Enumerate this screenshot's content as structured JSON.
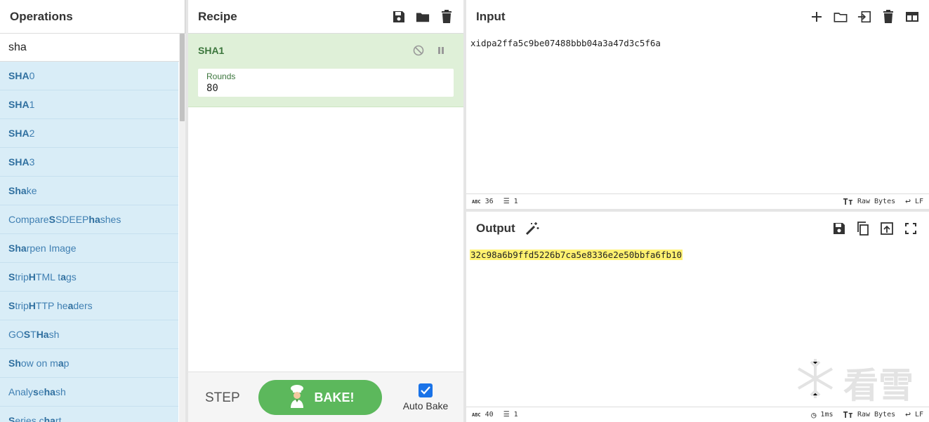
{
  "operations": {
    "title": "Operations",
    "search_value": "sha",
    "items": [
      {
        "pre": "",
        "bold": "SHA",
        "post": "0"
      },
      {
        "pre": "",
        "bold": "SHA",
        "post": "1"
      },
      {
        "pre": "",
        "bold": "SHA",
        "post": "2"
      },
      {
        "pre": "",
        "bold": "SHA",
        "post": "3"
      },
      {
        "pre": "",
        "bold": "Sha",
        "post": "ke"
      },
      {
        "pre": "Compare ",
        "bold": "S",
        "post": "SDEEP ",
        "bold2": "ha",
        "post2": "shes"
      },
      {
        "pre": "",
        "bold": "Sha",
        "post": "rpen Image"
      },
      {
        "pre": "",
        "bold": "S",
        "post": "trip ",
        "bold2": "H",
        "post2": "TML t",
        "bold3": "a",
        "post3": "gs"
      },
      {
        "pre": "",
        "bold": "S",
        "post": "trip ",
        "bold2": "H",
        "post2": "TTP he",
        "bold3": "a",
        "post3": "ders"
      },
      {
        "pre": "GO",
        "bold": "S",
        "post": "T ",
        "bold2": "Ha",
        "post2": "sh"
      },
      {
        "pre": "",
        "bold": "Sh",
        "post": "ow on m",
        "bold2": "a",
        "post2": "p"
      },
      {
        "pre": "Analy",
        "bold": "s",
        "post": "e ",
        "bold2": "ha",
        "post2": "sh"
      },
      {
        "pre": "",
        "bold": "S",
        "post": "eries c",
        "bold2": "ha",
        "post2": "rt"
      }
    ]
  },
  "recipe": {
    "title": "Recipe",
    "operation": {
      "name": "SHA1",
      "arg_label": "Rounds",
      "arg_value": "80"
    },
    "step_label": "STEP",
    "bake_label": "BAKE!",
    "autobake_label": "Auto Bake"
  },
  "input": {
    "title": "Input",
    "value": "xidpa2ffa5c9be07488bbb04a3a47d3c5f6a",
    "status_length": "36",
    "status_lines": "1",
    "status_encoding": "Raw Bytes",
    "status_eol": "LF"
  },
  "output": {
    "title": "Output",
    "value": "32c98a6b9ffd5226b7ca5e8336e2e50bbfa6fb10",
    "status_length": "40",
    "status_lines": "1",
    "status_time": "1ms",
    "status_encoding": "Raw Bytes",
    "status_eol": "LF"
  },
  "watermark_text": "看雪",
  "colors": {
    "op_item_bg": "#d9edf7",
    "recipe_op_bg": "#dff0d8",
    "bake_green": "#5cb85c",
    "output_highlight": "#fff170"
  }
}
